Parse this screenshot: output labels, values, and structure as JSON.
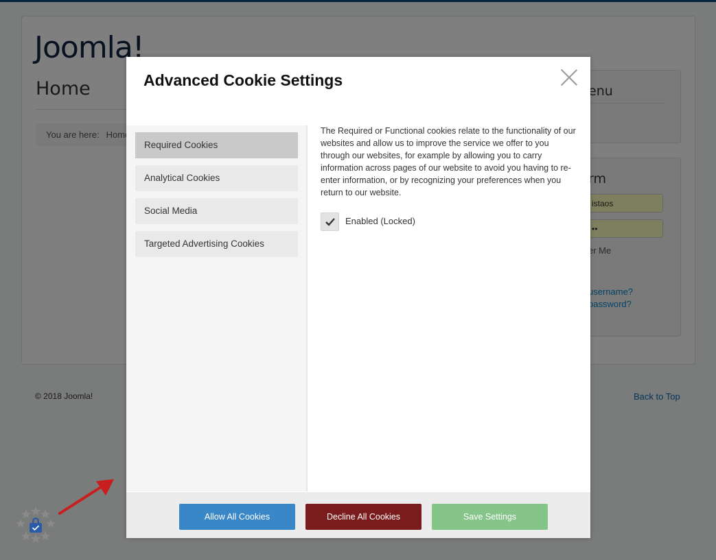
{
  "site": {
    "brand": "Joomla!",
    "page_title": "Home",
    "breadcrumb_prefix": "You are here:",
    "breadcrumb_home": "Home",
    "menu_heading": "enu",
    "form_heading": "rm",
    "username_value": "istaos",
    "password_value": "••",
    "remember_label": "er Me",
    "forgot_username": "username?",
    "forgot_password": "password?",
    "footer_copyright": "© 2018 Joomla!",
    "back_to_top": "Back to Top"
  },
  "modal": {
    "title": "Advanced Cookie Settings",
    "close_icon": "close-icon",
    "tabs": [
      {
        "label": "Required Cookies",
        "active": true
      },
      {
        "label": "Analytical Cookies",
        "active": false
      },
      {
        "label": "Social Media",
        "active": false
      },
      {
        "label": "Targeted Advertising Cookies",
        "active": false
      }
    ],
    "description": "The Required or Functional cookies relate to the functionality of our websites and allow us to improve the service we offer to you through our websites, for example by allowing you to carry information across pages of our website to avoid you having to re-enter information, or by recognizing your preferences when you return to our website.",
    "toggle": {
      "label": "Enabled (Locked)",
      "checked": true,
      "icon": "checkmark-icon"
    },
    "buttons": {
      "allow": "Allow All Cookies",
      "decline": "Decline All Cookies",
      "save": "Save Settings"
    }
  },
  "colors": {
    "allow_button": "#3a87c8",
    "decline_button": "#7b1c1c",
    "save_button": "#86c58a",
    "badge_blue": "#2b5aa6",
    "arrow_red": "#c81e1e"
  },
  "badge_icon": "cookie-lock-stars-icon",
  "arrow_icon": "red-arrow-icon"
}
